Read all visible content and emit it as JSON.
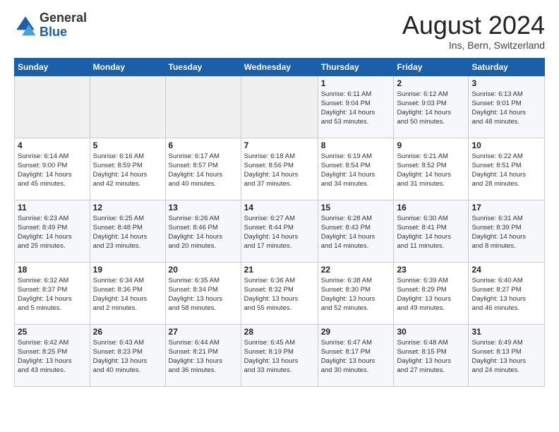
{
  "header": {
    "logo_general": "General",
    "logo_blue": "Blue",
    "month_title": "August 2024",
    "location": "Ins, Bern, Switzerland"
  },
  "weekdays": [
    "Sunday",
    "Monday",
    "Tuesday",
    "Wednesday",
    "Thursday",
    "Friday",
    "Saturday"
  ],
  "weeks": [
    [
      {
        "day": "",
        "info": ""
      },
      {
        "day": "",
        "info": ""
      },
      {
        "day": "",
        "info": ""
      },
      {
        "day": "",
        "info": ""
      },
      {
        "day": "1",
        "info": "Sunrise: 6:11 AM\nSunset: 9:04 PM\nDaylight: 14 hours\nand 53 minutes."
      },
      {
        "day": "2",
        "info": "Sunrise: 6:12 AM\nSunset: 9:03 PM\nDaylight: 14 hours\nand 50 minutes."
      },
      {
        "day": "3",
        "info": "Sunrise: 6:13 AM\nSunset: 9:01 PM\nDaylight: 14 hours\nand 48 minutes."
      }
    ],
    [
      {
        "day": "4",
        "info": "Sunrise: 6:14 AM\nSunset: 9:00 PM\nDaylight: 14 hours\nand 45 minutes."
      },
      {
        "day": "5",
        "info": "Sunrise: 6:16 AM\nSunset: 8:59 PM\nDaylight: 14 hours\nand 42 minutes."
      },
      {
        "day": "6",
        "info": "Sunrise: 6:17 AM\nSunset: 8:57 PM\nDaylight: 14 hours\nand 40 minutes."
      },
      {
        "day": "7",
        "info": "Sunrise: 6:18 AM\nSunset: 8:56 PM\nDaylight: 14 hours\nand 37 minutes."
      },
      {
        "day": "8",
        "info": "Sunrise: 6:19 AM\nSunset: 8:54 PM\nDaylight: 14 hours\nand 34 minutes."
      },
      {
        "day": "9",
        "info": "Sunrise: 6:21 AM\nSunset: 8:52 PM\nDaylight: 14 hours\nand 31 minutes."
      },
      {
        "day": "10",
        "info": "Sunrise: 6:22 AM\nSunset: 8:51 PM\nDaylight: 14 hours\nand 28 minutes."
      }
    ],
    [
      {
        "day": "11",
        "info": "Sunrise: 6:23 AM\nSunset: 8:49 PM\nDaylight: 14 hours\nand 25 minutes."
      },
      {
        "day": "12",
        "info": "Sunrise: 6:25 AM\nSunset: 8:48 PM\nDaylight: 14 hours\nand 23 minutes."
      },
      {
        "day": "13",
        "info": "Sunrise: 6:26 AM\nSunset: 8:46 PM\nDaylight: 14 hours\nand 20 minutes."
      },
      {
        "day": "14",
        "info": "Sunrise: 6:27 AM\nSunset: 8:44 PM\nDaylight: 14 hours\nand 17 minutes."
      },
      {
        "day": "15",
        "info": "Sunrise: 6:28 AM\nSunset: 8:43 PM\nDaylight: 14 hours\nand 14 minutes."
      },
      {
        "day": "16",
        "info": "Sunrise: 6:30 AM\nSunset: 8:41 PM\nDaylight: 14 hours\nand 11 minutes."
      },
      {
        "day": "17",
        "info": "Sunrise: 6:31 AM\nSunset: 8:39 PM\nDaylight: 14 hours\nand 8 minutes."
      }
    ],
    [
      {
        "day": "18",
        "info": "Sunrise: 6:32 AM\nSunset: 8:37 PM\nDaylight: 14 hours\nand 5 minutes."
      },
      {
        "day": "19",
        "info": "Sunrise: 6:34 AM\nSunset: 8:36 PM\nDaylight: 14 hours\nand 2 minutes."
      },
      {
        "day": "20",
        "info": "Sunrise: 6:35 AM\nSunset: 8:34 PM\nDaylight: 13 hours\nand 58 minutes."
      },
      {
        "day": "21",
        "info": "Sunrise: 6:36 AM\nSunset: 8:32 PM\nDaylight: 13 hours\nand 55 minutes."
      },
      {
        "day": "22",
        "info": "Sunrise: 6:38 AM\nSunset: 8:30 PM\nDaylight: 13 hours\nand 52 minutes."
      },
      {
        "day": "23",
        "info": "Sunrise: 6:39 AM\nSunset: 8:29 PM\nDaylight: 13 hours\nand 49 minutes."
      },
      {
        "day": "24",
        "info": "Sunrise: 6:40 AM\nSunset: 8:27 PM\nDaylight: 13 hours\nand 46 minutes."
      }
    ],
    [
      {
        "day": "25",
        "info": "Sunrise: 6:42 AM\nSunset: 8:25 PM\nDaylight: 13 hours\nand 43 minutes."
      },
      {
        "day": "26",
        "info": "Sunrise: 6:43 AM\nSunset: 8:23 PM\nDaylight: 13 hours\nand 40 minutes."
      },
      {
        "day": "27",
        "info": "Sunrise: 6:44 AM\nSunset: 8:21 PM\nDaylight: 13 hours\nand 36 minutes."
      },
      {
        "day": "28",
        "info": "Sunrise: 6:45 AM\nSunset: 8:19 PM\nDaylight: 13 hours\nand 33 minutes."
      },
      {
        "day": "29",
        "info": "Sunrise: 6:47 AM\nSunset: 8:17 PM\nDaylight: 13 hours\nand 30 minutes."
      },
      {
        "day": "30",
        "info": "Sunrise: 6:48 AM\nSunset: 8:15 PM\nDaylight: 13 hours\nand 27 minutes."
      },
      {
        "day": "31",
        "info": "Sunrise: 6:49 AM\nSunset: 8:13 PM\nDaylight: 13 hours\nand 24 minutes."
      }
    ]
  ]
}
